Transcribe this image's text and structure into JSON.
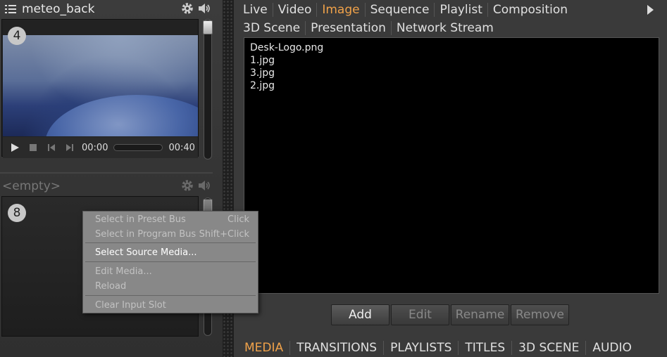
{
  "left_panel": {
    "slot1": {
      "title": "meteo_back",
      "number": "4",
      "time_current": "00:00",
      "time_total": "00:40"
    },
    "slot2": {
      "title": "<empty>",
      "number": "8"
    }
  },
  "context_menu": {
    "items": [
      {
        "label": "Select in Preset Bus",
        "shortcut": "Click"
      },
      {
        "label": "Select in Program Bus",
        "shortcut": "Shift+Click"
      },
      {
        "label": "Select Source Media..."
      },
      {
        "label": "Edit Media..."
      },
      {
        "label": "Reload"
      },
      {
        "label": "Clear Input Slot"
      }
    ]
  },
  "right_panel": {
    "tabs_row1": [
      "Live",
      "Video",
      "Image",
      "Sequence",
      "Playlist",
      "Composition"
    ],
    "tabs_row2": [
      "3D Scene",
      "Presentation",
      "Network Stream"
    ],
    "files": [
      "Desk-Logo.png",
      "1.jpg",
      "3.jpg",
      "2.jpg"
    ],
    "buttons": {
      "add": "Add",
      "edit": "Edit",
      "rename": "Rename",
      "remove": "Remove"
    },
    "bottom_tabs": [
      "MEDIA",
      "TRANSITIONS",
      "PLAYLISTS",
      "TITLES",
      "3D SCENE",
      "AUDIO"
    ]
  },
  "colors": {
    "accent": "#f0a24a",
    "background": "#3a3a3a"
  },
  "icons": [
    "list-icon",
    "gear-icon",
    "speaker-icon",
    "play-icon",
    "stop-icon",
    "skip-back-icon",
    "skip-forward-icon",
    "chevron-right-icon"
  ]
}
